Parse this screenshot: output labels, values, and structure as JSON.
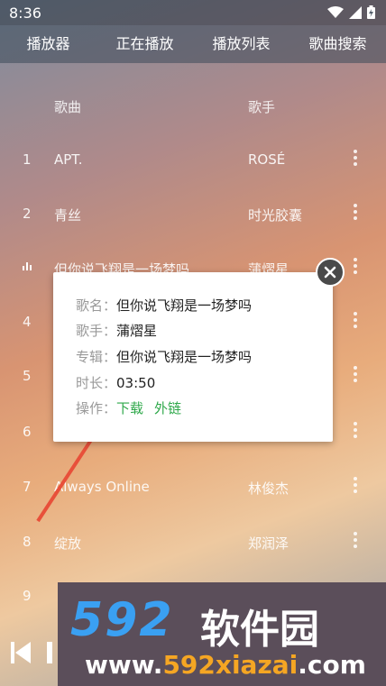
{
  "status_bar": {
    "time": "8:36"
  },
  "tabs": [
    {
      "label": "播放器"
    },
    {
      "label": "正在播放"
    },
    {
      "label": "播放列表"
    },
    {
      "label": "歌曲搜索"
    }
  ],
  "list_header": {
    "song": "歌曲",
    "artist": "歌手"
  },
  "rows": [
    {
      "num": "1",
      "title": "APT.",
      "artist": "ROSÉ"
    },
    {
      "num": "2",
      "title": "青丝",
      "artist": "时光胶囊"
    },
    {
      "num": "",
      "title": "但你说飞翔是一场梦吗",
      "artist": "蒲熠星",
      "playing": true
    },
    {
      "num": "4",
      "title": "",
      "artist": ""
    },
    {
      "num": "5",
      "title": "",
      "artist": ""
    },
    {
      "num": "6",
      "title": "",
      "artist": ""
    },
    {
      "num": "7",
      "title": "Always Online",
      "artist": "林俊杰"
    },
    {
      "num": "8",
      "title": "绽放",
      "artist": "郑润泽"
    },
    {
      "num": "9",
      "title": "",
      "artist": ""
    }
  ],
  "popup": {
    "name_label": "歌名：",
    "name_value": "但你说飞翔是一场梦吗",
    "artist_label": "歌手：",
    "artist_value": "蒲熠星",
    "album_label": "专辑：",
    "album_value": "但你说飞翔是一场梦吗",
    "duration_label": "时长：",
    "duration_value": "03:50",
    "action_label": "操作：",
    "download_label": "下载",
    "link_label": "外链"
  },
  "watermark": {
    "logo": "592",
    "cn": "软件园",
    "url_prefix": "www.",
    "url_main": "592xiazai",
    "url_suffix": ".com"
  },
  "colors": {
    "accent_green": "#2ea84a",
    "arrow_red": "#e8503a"
  }
}
